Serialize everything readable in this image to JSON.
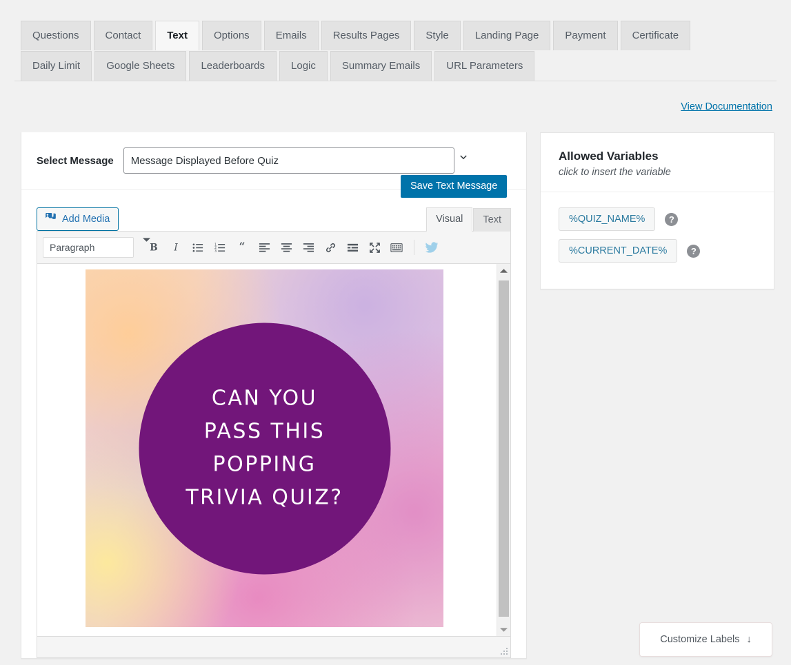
{
  "tabs": {
    "row1": [
      {
        "label": "Questions",
        "active": false
      },
      {
        "label": "Contact",
        "active": false
      },
      {
        "label": "Text",
        "active": true
      },
      {
        "label": "Options",
        "active": false
      },
      {
        "label": "Emails",
        "active": false
      },
      {
        "label": "Results Pages",
        "active": false
      },
      {
        "label": "Style",
        "active": false
      },
      {
        "label": "Landing Page",
        "active": false
      },
      {
        "label": "Payment",
        "active": false
      },
      {
        "label": "Certificate",
        "active": false
      }
    ],
    "row2": [
      {
        "label": "Daily Limit",
        "active": false
      },
      {
        "label": "Google Sheets",
        "active": false
      },
      {
        "label": "Leaderboards",
        "active": false
      },
      {
        "label": "Logic",
        "active": false
      },
      {
        "label": "Summary Emails",
        "active": false
      },
      {
        "label": "URL Parameters",
        "active": false
      }
    ]
  },
  "doc_link": {
    "label": "View Documentation"
  },
  "select_message": {
    "label": "Select Message",
    "value": "Message Displayed Before Quiz",
    "save_label": "Save Text Message"
  },
  "editor": {
    "add_media_label": "Add Media",
    "tabs": [
      {
        "label": "Visual",
        "active": true
      },
      {
        "label": "Text",
        "active": false
      }
    ],
    "format_value": "Paragraph",
    "toolbar": [
      {
        "name": "bold-icon",
        "title": "Bold"
      },
      {
        "name": "italic-icon",
        "title": "Italic"
      },
      {
        "name": "bulleted-list-icon",
        "title": "Bulleted list"
      },
      {
        "name": "numbered-list-icon",
        "title": "Numbered list"
      },
      {
        "name": "blockquote-icon",
        "title": "Blockquote"
      },
      {
        "name": "align-left-icon",
        "title": "Align left"
      },
      {
        "name": "align-center-icon",
        "title": "Align center"
      },
      {
        "name": "align-right-icon",
        "title": "Align right"
      },
      {
        "name": "link-icon",
        "title": "Insert/edit link"
      },
      {
        "name": "read-more-icon",
        "title": "Insert Read More tag"
      },
      {
        "name": "fullscreen-icon",
        "title": "Distraction-free writing mode"
      },
      {
        "name": "toolbar-toggle-icon",
        "title": "Toolbar Toggle"
      },
      {
        "name": "twitter-bird-icon",
        "title": "Twitter"
      }
    ],
    "content_image": {
      "name": "quiz-promo-image",
      "circle_color": "#72167a",
      "lines": [
        "Can You",
        "Pass This",
        "Popping",
        "Trivia Quiz?"
      ]
    }
  },
  "allowed_variables": {
    "title": "Allowed Variables",
    "subtitle": "click to insert the variable",
    "items": [
      {
        "label": "%QUIZ_NAME%",
        "help": "?"
      },
      {
        "label": "%CURRENT_DATE%",
        "help": "?"
      }
    ]
  },
  "customize_labels": {
    "label": "Customize Labels",
    "arrow": "↓"
  },
  "colors": {
    "accent_blue": "#0073aa",
    "link_blue": "#2271b1",
    "chip_text": "#2c7ba0",
    "page_bg": "#f1f1f1",
    "panel_bg": "#ffffff"
  }
}
